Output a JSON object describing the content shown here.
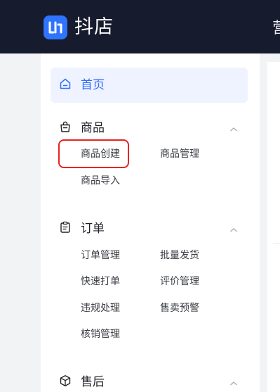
{
  "header": {
    "logo_text": "抖店",
    "cut_text": "营"
  },
  "sidebar": {
    "home": {
      "label": "首页",
      "icon": "home-icon"
    },
    "groups": [
      {
        "title": "商品",
        "icon": "bag-icon",
        "items": [
          "商品创建",
          "商品管理",
          "商品导入"
        ]
      },
      {
        "title": "订单",
        "icon": "clipboard-icon",
        "items": [
          "订单管理",
          "批量发货",
          "快速打单",
          "评价管理",
          "违规处理",
          "售卖预警",
          "核销管理"
        ]
      },
      {
        "title": "售后",
        "icon": "box-icon",
        "items": []
      }
    ]
  },
  "colors": {
    "topbar": "#161b2e",
    "accent": "#2f6bff",
    "highlight": "#e8231f"
  }
}
